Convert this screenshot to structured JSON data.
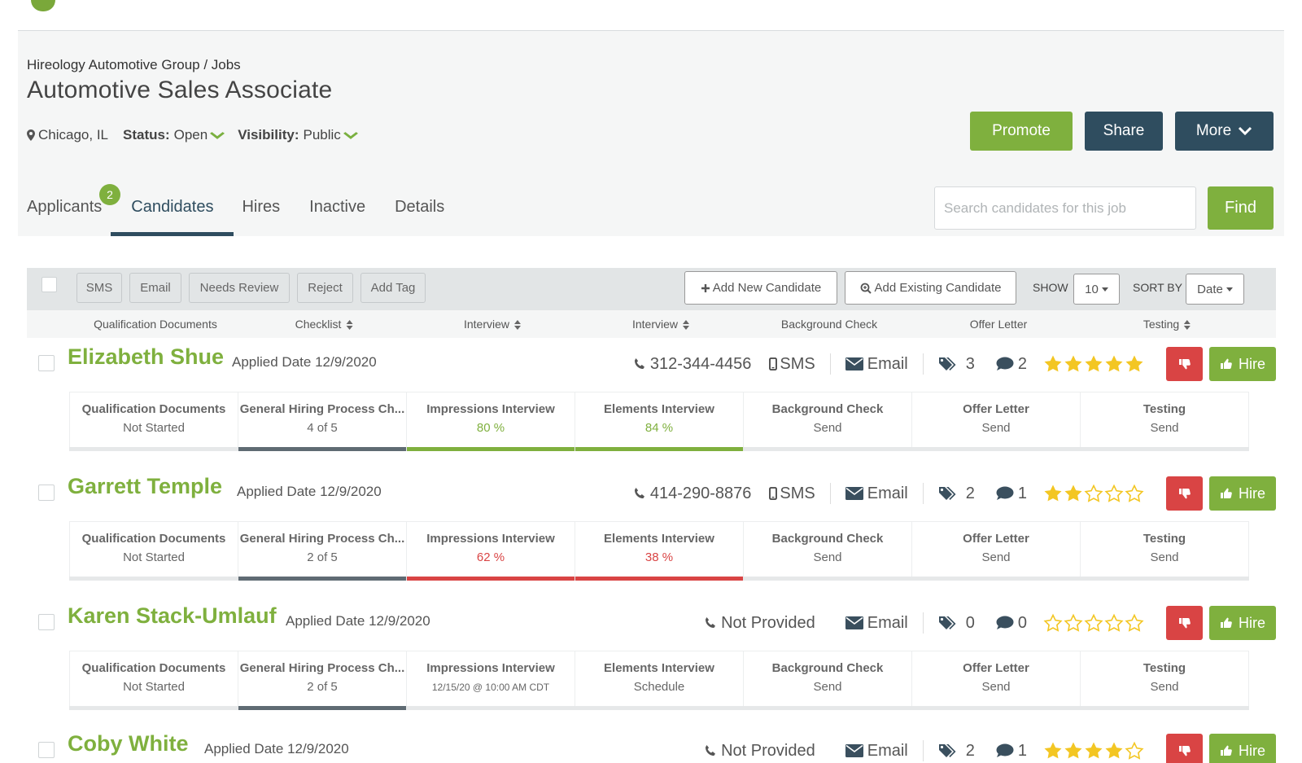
{
  "colors": {
    "brand_green": "#7fb03e",
    "navy": "#2f4d5f",
    "reject_red": "#d94444",
    "star_gold": "#f3c623",
    "progress_gray": "#5f6b73"
  },
  "header": {
    "breadcrumb": "Hireology Automotive Group / Jobs",
    "title": "Automotive Sales Associate",
    "location": "Chicago, IL",
    "status_label": "Status:",
    "status_value": "Open",
    "visibility_label": "Visibility:",
    "visibility_value": "Public",
    "promote": "Promote",
    "share": "Share",
    "more": "More"
  },
  "tabs": [
    {
      "label": "Applicants",
      "badge": "2"
    },
    {
      "label": "Candidates"
    },
    {
      "label": "Hires"
    },
    {
      "label": "Inactive"
    },
    {
      "label": "Details"
    }
  ],
  "search": {
    "placeholder": "Search candidates for this job",
    "find": "Find"
  },
  "toolbar": {
    "sms": "SMS",
    "email": "Email",
    "needs_review": "Needs Review",
    "reject": "Reject",
    "add_tag": "Add Tag",
    "add_new": "Add New Candidate",
    "add_existing": "Add Existing Candidate",
    "show_label": "SHOW",
    "show_value": "10",
    "sort_label": "SORT BY",
    "sort_value": "Date"
  },
  "columns": [
    "Qualification Documents",
    "Checklist",
    "Interview",
    "Interview",
    "Background Check",
    "Offer Letter",
    "Testing"
  ],
  "candidates": [
    {
      "name": "Elizabeth Shue",
      "applied": "Applied Date 12/9/2020",
      "phone": "312-344-4456",
      "sms": "SMS",
      "email": "Email",
      "tags": "3",
      "comments": "2",
      "rating": 5,
      "hire": "Hire",
      "steps": [
        {
          "name": "Qualification Documents",
          "value": "Not Started"
        },
        {
          "name": "General Hiring Process Ch...",
          "value": "4 of 5"
        },
        {
          "name": "Impressions Interview",
          "value": "80 %"
        },
        {
          "name": "Elements Interview",
          "value": "84 %"
        },
        {
          "name": "Background Check",
          "value": "Send"
        },
        {
          "name": "Offer Letter",
          "value": "Send"
        },
        {
          "name": "Testing",
          "value": "Send"
        }
      ]
    },
    {
      "name": "Garrett Temple",
      "applied": "Applied Date 12/9/2020",
      "phone": "414-290-8876",
      "sms": "SMS",
      "email": "Email",
      "tags": "2",
      "comments": "1",
      "rating": 2,
      "hire": "Hire",
      "steps": [
        {
          "name": "Qualification Documents",
          "value": "Not Started"
        },
        {
          "name": "General Hiring Process Ch...",
          "value": "2 of 5"
        },
        {
          "name": "Impressions Interview",
          "value": "62 %"
        },
        {
          "name": "Elements Interview",
          "value": "38 %"
        },
        {
          "name": "Background Check",
          "value": "Send"
        },
        {
          "name": "Offer Letter",
          "value": "Send"
        },
        {
          "name": "Testing",
          "value": "Send"
        }
      ]
    },
    {
      "name": "Karen Stack-Umlauf",
      "applied": "Applied Date 12/9/2020",
      "phone": "Not Provided",
      "email": "Email",
      "tags": "0",
      "comments": "0",
      "rating": 0,
      "hire": "Hire",
      "steps": [
        {
          "name": "Qualification Documents",
          "value": "Not Started"
        },
        {
          "name": "General Hiring Process Ch...",
          "value": "2 of 5"
        },
        {
          "name": "Impressions Interview",
          "value": "12/15/20 @ 10:00 AM CDT"
        },
        {
          "name": "Elements Interview",
          "value": "Schedule"
        },
        {
          "name": "Background Check",
          "value": "Send"
        },
        {
          "name": "Offer Letter",
          "value": "Send"
        },
        {
          "name": "Testing",
          "value": "Send"
        }
      ]
    },
    {
      "name": "Coby White",
      "applied": "Applied Date 12/9/2020",
      "phone": "Not Provided",
      "email": "Email",
      "tags": "2",
      "comments": "1",
      "rating": 4,
      "hire": "Hire"
    }
  ]
}
